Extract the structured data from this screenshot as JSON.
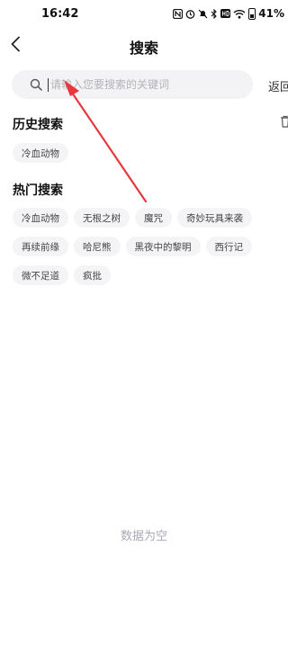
{
  "status_bar": {
    "time": "16:42",
    "battery": "41%",
    "icons": [
      "nfc-icon",
      "alarm-icon",
      "mute-icon",
      "bluetooth-icon",
      "hd-icon",
      "wifi-icon",
      "battery-icon"
    ]
  },
  "header": {
    "title": "搜索"
  },
  "search": {
    "placeholder": "请输入您要搜索的关键词",
    "value": "",
    "return_label": "返回"
  },
  "history": {
    "title": "历史搜索",
    "items": [
      "冷血动物"
    ]
  },
  "hot": {
    "title": "热门搜索",
    "rows": [
      [
        "冷血动物",
        "无根之树",
        "魔咒",
        "奇妙玩具来袭"
      ],
      [
        "再续前缘",
        "哈尼熊",
        "黑夜中的黎明",
        "西行记"
      ],
      [
        "微不足道",
        "疯批"
      ]
    ]
  },
  "empty_text": "数据为空",
  "colors": {
    "annotation_arrow": "#e8383d",
    "search_bg": "#f3f3f5",
    "tag_bg": "#f4f4f6"
  }
}
